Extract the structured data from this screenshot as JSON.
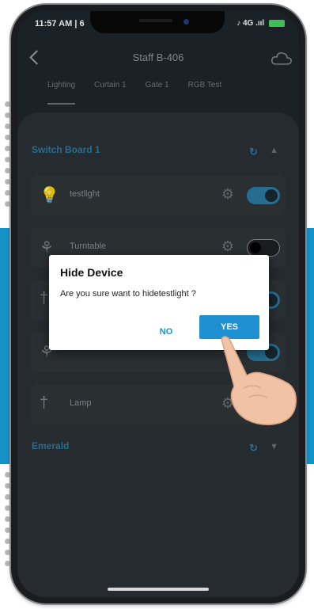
{
  "status_bar": {
    "time": "11:57 AM | 6",
    "icons_text": "♪ 4G .ııl"
  },
  "header": {
    "title": "Staff B-406"
  },
  "tabs": [
    {
      "label": "Lighting",
      "active": true
    },
    {
      "label": "Curtain 1",
      "active": false
    },
    {
      "label": "Gate 1",
      "active": false
    },
    {
      "label": "RGB Test",
      "active": false
    }
  ],
  "groups": [
    {
      "name": "Switch Board 1",
      "devices": [
        {
          "name": "testlight",
          "state": "on",
          "icon": "bulb-icon"
        },
        {
          "name": "Turntable",
          "state": "off",
          "icon": "fan-icon"
        },
        {
          "name": "",
          "state": "on",
          "icon": "lamp-icon"
        },
        {
          "name": "",
          "state": "on",
          "icon": "fan-icon"
        },
        {
          "name": "Lamp",
          "state": "on",
          "icon": "lamp-icon"
        }
      ]
    },
    {
      "name": "Emerald",
      "devices": []
    }
  ],
  "dialog": {
    "title": "Hide Device",
    "message": "Are you sure want to hidetestlight ?",
    "no_label": "NO",
    "yes_label": "YES"
  },
  "colors": {
    "accent": "#1e8fd0",
    "background_band": "#1592c8",
    "screen_bg": "#1f272d"
  }
}
